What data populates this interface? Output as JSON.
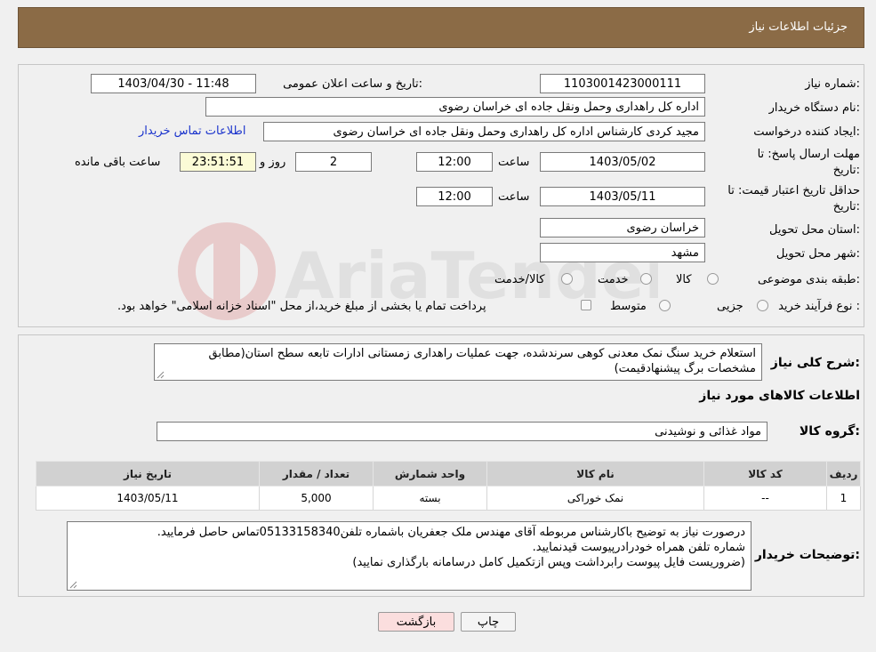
{
  "header": {
    "title": "جزئیات اطلاعات نیاز"
  },
  "form": {
    "need_number_label": "شماره نیاز:",
    "need_number": "1103001423000111",
    "announce_label": "تاریخ و ساعت اعلان عمومی:",
    "announce_value": "1403/04/30 - 11:48",
    "buyer_org_label": "نام دستگاه خریدار:",
    "buyer_org": "اداره کل راهداری وحمل ونقل جاده ای خراسان رضوی",
    "creator_label": "ایجاد کننده درخواست:",
    "creator": "مجید کردی کارشناس اداره کل راهداری وحمل ونقل جاده ای خراسان رضوی",
    "contact_link": "اطلاعات تماس خریدار",
    "deadline_label_1": "مهلت ارسال پاسخ: تا",
    "deadline_label_2": "تاریخ:",
    "deadline_date": "1403/05/02",
    "time_label": "ساعت",
    "deadline_time": "12:00",
    "days_value": "2",
    "days_label": "روز و",
    "remaining_time": "23:51:51",
    "remaining_label": "ساعت باقی مانده",
    "validity_label_1": "حداقل تاریخ اعتبار قیمت: تا",
    "validity_label_2": "تاریخ:",
    "validity_date": "1403/05/11",
    "validity_time": "12:00",
    "province_label": "استان محل تحویل:",
    "province": "خراسان رضوی",
    "city_label": "شهر محل تحویل:",
    "city": "مشهد",
    "category_label": "طبقه بندی موضوعی:",
    "category_options": [
      "کالا",
      "خدمت",
      "کالا/خدمت"
    ],
    "process_label": "نوع فرآیند خرید :",
    "process_options": [
      "جزیی",
      "متوسط"
    ],
    "process_note": "پرداخت تمام یا بخشی از مبلغ خرید،از محل \"اسناد خزانه اسلامی\" خواهد بود."
  },
  "description": {
    "label": "شرح کلی نیاز:",
    "text": "استعلام خرید سنگ نمک معدنی کوهی سرندشده، جهت عملیات راهداری زمستانی ادارات تابعه سطح استان(مطابق مشخصات برگ پیشنهادقیمت)"
  },
  "goods": {
    "section_title": "اطلاعات کالاهای مورد نیاز",
    "group_label": "گروه کالا:",
    "group_value": "مواد غذائی و نوشیدنی",
    "columns": [
      "ردیف",
      "کد کالا",
      "نام کالا",
      "واحد شمارش",
      "تعداد / مقدار",
      "تاریخ نیاز"
    ],
    "rows": [
      {
        "row": "1",
        "code": "--",
        "name": "نمک خوراکی",
        "unit": "بسته",
        "qty": "5,000",
        "date": "1403/05/11"
      }
    ]
  },
  "buyer_notes": {
    "label": "توضیحات خریدار:",
    "lines": [
      "درصورت نیاز به توضیح باکارشناس مربوطه آقای مهندس ملک جعفریان باشماره تلفن05133158340تماس حاصل فرمایید.",
      "شماره تلفن همراه خودرادرپیوست قیدنمایید.",
      "(ضروریست فایل پیوست رابرداشت وپس ازتکمیل کامل درسامانه بارگذاری نمایید)"
    ]
  },
  "buttons": {
    "print": "چاپ",
    "back": "بازگشت"
  },
  "watermark": {
    "text": "AriaTender.neT"
  },
  "colors": {
    "header_bg": "#8b6b46",
    "link": "#1a33cc",
    "back_btn_bg": "#fbdede",
    "remaining_bg": "#fbfbd6"
  }
}
